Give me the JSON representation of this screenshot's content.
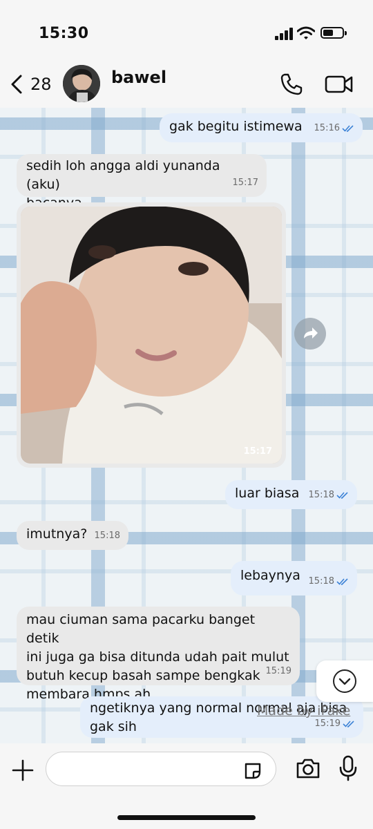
{
  "status_bar": {
    "time": "15:30"
  },
  "header": {
    "back_count": "28",
    "contact_name": "bawel"
  },
  "messages": [
    {
      "text": "gak begitu istimewa",
      "time": "15:16"
    },
    {
      "text": "sedih loh angga aldi yunanda (aku)\nbacanya",
      "time": "15:17"
    },
    {
      "time": "15:17"
    },
    {
      "text": "luar biasa",
      "time": "15:18"
    },
    {
      "text": "imutnya?",
      "time": "15:18"
    },
    {
      "text": "lebaynya",
      "time": "15:18"
    },
    {
      "text": "mau ciuman sama pacarku banget detik\nini juga ga bisa ditunda udah pait mulut\nbutuh kecup basah sampe bengkak\nmembara hmps ah",
      "time": "15:19"
    },
    {
      "text": "ngetiknya yang normal normal aja bisa\ngak sih",
      "time": "15:19"
    }
  ],
  "watermark": "Made by iFake",
  "colors": {
    "outgoing_bubble": "#e4eefb",
    "incoming_bubble": "#e9e9e9",
    "read_ticks": "#3c82d6"
  }
}
